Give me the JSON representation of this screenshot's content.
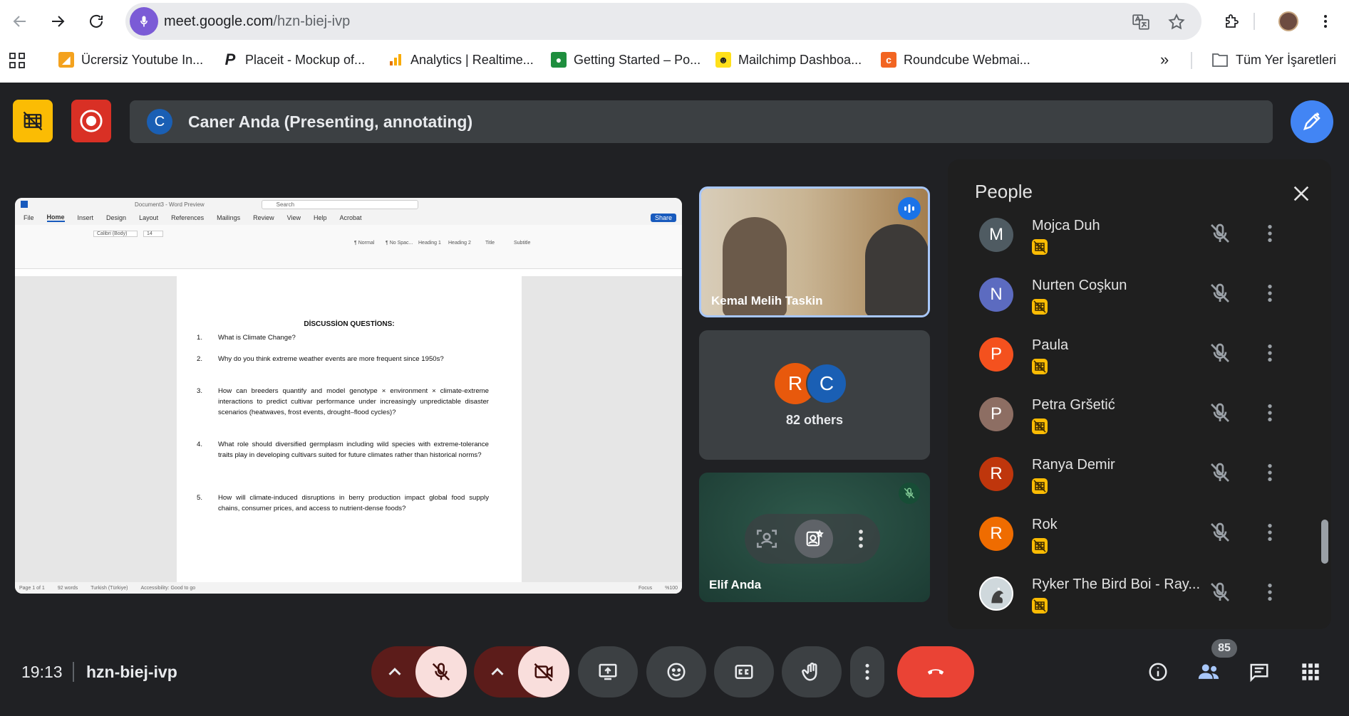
{
  "browser": {
    "url_host": "meet.google.com",
    "url_path": "/hzn-biej-ivp",
    "bookmarks": [
      {
        "label": "Ücrersiz Youtube In...",
        "icon": "bird-icon",
        "color": "#f4a21e"
      },
      {
        "label": "Placeit - Mockup of...",
        "icon": "placeit-icon",
        "color": "#202124"
      },
      {
        "label": "Analytics | Realtime...",
        "icon": "analytics-icon",
        "color": "#f9ab00"
      },
      {
        "label": "Getting Started – Po...",
        "icon": "getting-started-icon",
        "color": "#1e8e3e"
      },
      {
        "label": "Mailchimp Dashboa...",
        "icon": "mailchimp-icon",
        "color": "#ffe01b"
      },
      {
        "label": "Roundcube Webmai...",
        "icon": "roundcube-icon",
        "color": "#f26522"
      }
    ],
    "all_bookmarks_label": "Tüm Yer İşaretleri"
  },
  "meeting": {
    "presenter_initial": "C",
    "presenter_label": "Caner Anda (Presenting, annotating)",
    "time": "19:13",
    "code": "hzn-biej-ivp",
    "participant_count": "85"
  },
  "word": {
    "title": "Document3 - Word Preview",
    "search_placeholder": "Search",
    "share_label": "Share",
    "menu": [
      "File",
      "Home",
      "Insert",
      "Design",
      "Layout",
      "References",
      "Mailings",
      "Review",
      "View",
      "Help",
      "Acrobat"
    ],
    "font": "Calibri (Body)",
    "font_size": "14",
    "styles": [
      "¶ Normal",
      "¶ No Spac...",
      "Heading 1",
      "Heading 2",
      "Title",
      "Subtitle"
    ],
    "doc_title": "DİSCUSSİON QUESTİONS:",
    "questions": [
      {
        "n": "1.",
        "text": "What is Climate Change?"
      },
      {
        "n": "2.",
        "text": "Why do you think extreme weather events are more frequent since 1950s?"
      },
      {
        "n": "3.",
        "text": "How can breeders quantify and model genotype × environment × climate-extreme interactions to predict cultivar performance under increasingly unpredictable disaster scenarios (heatwaves, frost events, drought–flood cycles)?"
      },
      {
        "n": "4.",
        "text": "What role should diversified germplasm including wild species with extreme-tolerance traits play in developing cultivars suited for future climates rather than historical norms?"
      },
      {
        "n": "5.",
        "text": "How will climate-induced disruptions in berry production impact global food supply chains, consumer prices, and access to nutrient-dense foods?"
      }
    ],
    "status_page": "Page 1 of 1",
    "status_words": "92 words",
    "status_lang": "Turkish (Türkiye)",
    "status_access": "Accessibility: Good to go",
    "status_focus": "Focus",
    "zoom": "%100"
  },
  "tiles": {
    "speaker_name": "Kemal Melih Taskin",
    "others_initials": [
      "R",
      "C"
    ],
    "others_label": "82 others",
    "elif_name": "Elif Anda"
  },
  "people_panel": {
    "title": "People",
    "rows": [
      {
        "initial": "M",
        "name": "Mojca Duh",
        "color": "#4f5b62"
      },
      {
        "initial": "N",
        "name": "Nurten Coşkun",
        "color": "#5c6bc0"
      },
      {
        "initial": "P",
        "name": "Paula",
        "color": "#f4511e"
      },
      {
        "initial": "P",
        "name": "Petra Gršetić",
        "color": "#8d6e63"
      },
      {
        "initial": "R",
        "name": "Ranya Demir",
        "color": "#bf360c"
      },
      {
        "initial": "R",
        "name": "Rok",
        "color": "#ef6c00"
      },
      {
        "initial": "",
        "name": "Ryker The Bird Boi - Ray...",
        "color": "#cfd8dc"
      }
    ]
  }
}
